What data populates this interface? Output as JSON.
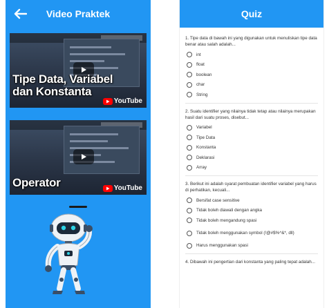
{
  "video_screen": {
    "title": "Video Praktek",
    "back_icon": "arrow-left-icon",
    "videos": [
      {
        "title": "Tipe Data, Variabel dan Konstanta",
        "platform": "YouTube"
      },
      {
        "title": "Operator",
        "platform": "YouTube"
      }
    ],
    "colors": {
      "primary": "#2196f3"
    }
  },
  "quiz_screen": {
    "title": "Quiz",
    "questions": [
      {
        "text": "1. Tipe data di bawah ini yang digunakan untuk menuliskan tipe data benar atau salah adalah...",
        "options": [
          "int",
          "float",
          "boolean",
          "char",
          "String"
        ]
      },
      {
        "text": "2. Suatu identifier yang nilainya tidak tetap atau nilainya merupakan hasil dari suatu proses, disebut...",
        "options": [
          "Variabel",
          "Tipe Data",
          "Konstanta",
          "Deklarasi",
          "Array"
        ]
      },
      {
        "text": "3. Berikut ini adalah syarat pembuatan identifier variabel yang harus di perhatikan, kecuali...",
        "options": [
          "Bersifat case sensitive",
          "Tidak boleh diawali dengan angka",
          "Tidak boleh mengandung spasi",
          "Tidak boleh menggunakan symbol (!@#$%^&*, dll)",
          "Harus menggunakan spasi"
        ]
      },
      {
        "text": "4. Dibawah ini pengertian dari konstanta yang paling tepat adalah...",
        "options": []
      }
    ]
  }
}
